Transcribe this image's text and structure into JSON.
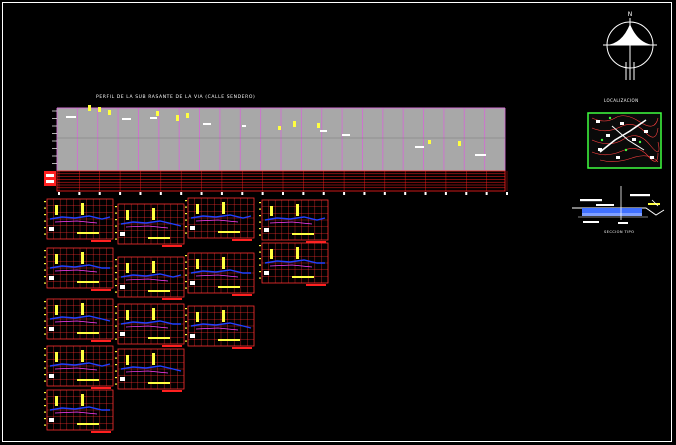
{
  "drawing": {
    "profile_title": "PERFIL DE LA SUB RASANTE DE LA VIA (CALLE SENDERO)",
    "location_label": "LOCALIZACION",
    "section_label": "SECCION TIPO",
    "north_label": "N"
  },
  "colors": {
    "background": "#000000",
    "profile_grid": "#d070d0",
    "profile_fill": "#a8a8a8",
    "band": "#ff2020",
    "section_grid": "#ff3030",
    "grade_line": "#2040ff",
    "annotation": "#ffff40",
    "location_border": "#40ff40"
  }
}
